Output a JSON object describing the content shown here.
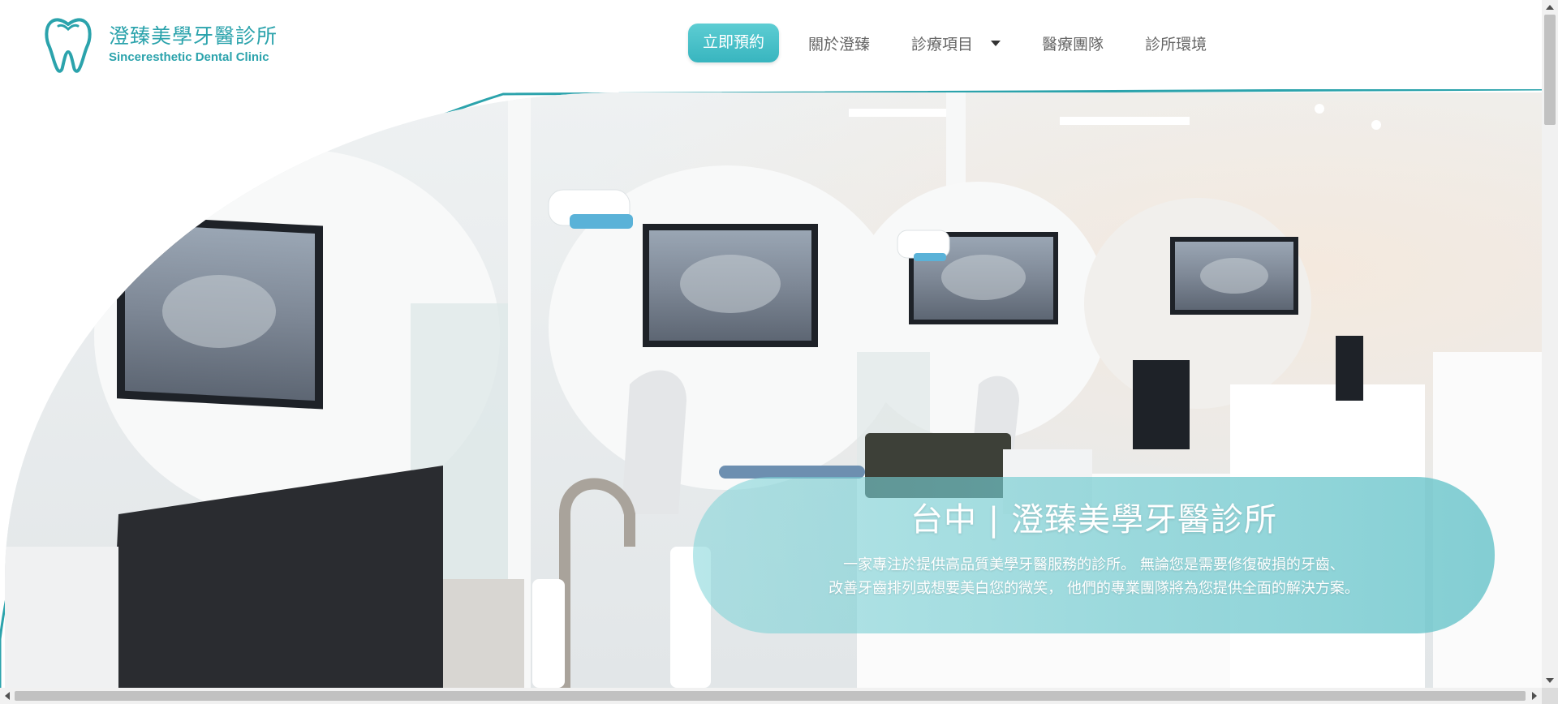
{
  "brand": {
    "name_cn": "澄臻美學牙醫診所",
    "name_en": "Sinceresthetic Dental Clinic",
    "logo_icon": "tooth-icon",
    "color": "#2ba3ac"
  },
  "nav": {
    "cta_label": "立即預約",
    "items": [
      {
        "label": "關於澄臻"
      },
      {
        "label": "診療項目",
        "dropdown_icon": "caret-down-icon"
      },
      {
        "label": "醫療團隊"
      },
      {
        "label": "診所環境"
      }
    ]
  },
  "hero": {
    "photo_alt": "clinic-interior-photo",
    "title": "台中 | 澄臻美學牙醫診所",
    "desc_line1": "一家專注於提供高品質美學牙醫服務的診所。 無論您是需要修復破損的牙齒、",
    "desc_line2": "改善牙齒排列或想要美白您的微笑， 他們的專業團隊將為您提供全面的解決方案。"
  },
  "colors": {
    "accent": "#3fb6be",
    "hero_border": "#2ba3ac",
    "caption_bg": "#7fd3d6"
  }
}
